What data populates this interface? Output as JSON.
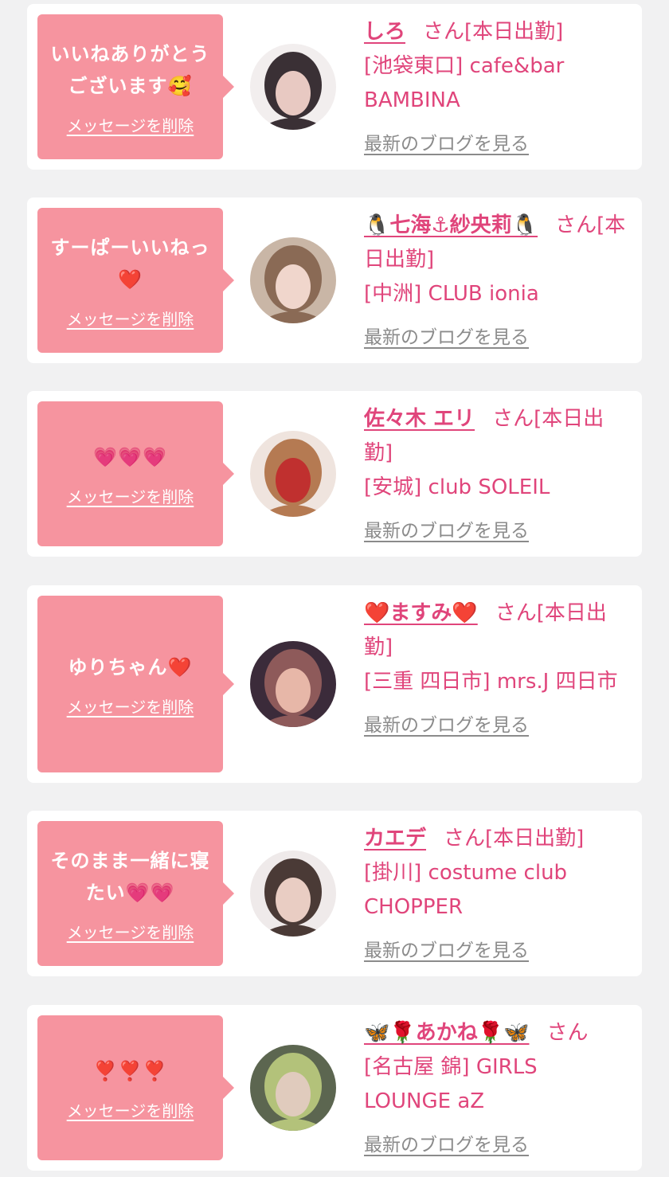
{
  "cards": [
    {
      "message": "いいねありがとうございます🥰",
      "delete_label": "メッセージを削除",
      "name": "しろ",
      "suffix": "さん[本日出勤]",
      "shop": "[池袋東口] cafe&bar BAMBINA",
      "blog_label": "最新のブログを見る",
      "avatar_colors": [
        "#f2eeee",
        "#3a3035",
        "#e8c9c2"
      ]
    },
    {
      "message": "すーぱーいいねっ❤️",
      "delete_label": "メッセージを削除",
      "name": "🐧七海⚓紗央莉🐧",
      "suffix": "さん[本日出勤]",
      "shop": "[中洲] CLUB ionia",
      "blog_label": "最新のブログを見る",
      "avatar_colors": [
        "#c9b6a6",
        "#8a6a55",
        "#f0d6cc"
      ]
    },
    {
      "message": "💗💗💗",
      "delete_label": "メッセージを削除",
      "name": "佐々木 エリ",
      "suffix": "さん[本日出勤]",
      "shop": "[安城] club SOLEIL",
      "blog_label": "最新のブログを見る",
      "avatar_colors": [
        "#efe4de",
        "#b57a52",
        "#c0302f"
      ]
    },
    {
      "message": "ゆりちゃん❤️",
      "delete_label": "メッセージを削除",
      "name": "❤️ますみ❤️",
      "suffix": "さん[本日出勤]",
      "shop": "[三重 四日市] mrs.J 四日市",
      "blog_label": "最新のブログを見る",
      "avatar_colors": [
        "#3b2b3a",
        "#8e5a5a",
        "#e7b7a8"
      ]
    },
    {
      "message": "そのまま一緒に寝たい💗💗",
      "delete_label": "メッセージを削除",
      "name": "カエデ",
      "suffix": "さん[本日出勤]",
      "shop": "[掛川] costume club CHOPPER",
      "blog_label": "最新のブログを見る",
      "avatar_colors": [
        "#efeaea",
        "#4a3a36",
        "#e9cdc3"
      ]
    },
    {
      "message": "❣️❣️❣️",
      "delete_label": "メッセージを削除",
      "name": "🦋🌹あかね🌹🦋",
      "suffix": "さん",
      "shop": "[名古屋 錦] GIRLS LOUNGE aZ",
      "blog_label": "最新のブログを見る",
      "avatar_colors": [
        "#5c6650",
        "#b3c27a",
        "#e0cbbd"
      ]
    }
  ]
}
